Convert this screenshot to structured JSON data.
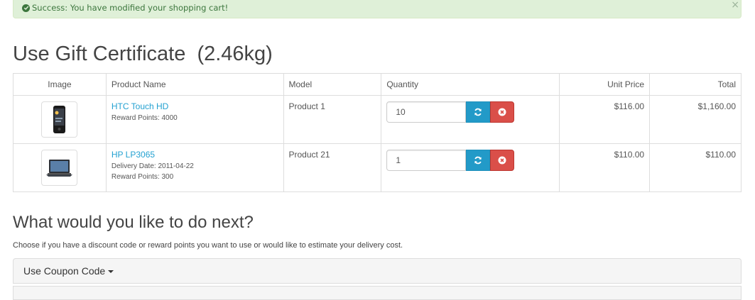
{
  "alert": {
    "message": "Success: You have modified your shopping cart!",
    "close": "×"
  },
  "page": {
    "title": "Use Gift Certificate  (2.46kg)"
  },
  "cart": {
    "headers": [
      "Image",
      "Product Name",
      "Model",
      "Quantity",
      "Unit Price",
      "Total"
    ],
    "rows": [
      {
        "name": "HTC Touch HD",
        "meta": [
          "Reward Points: 4000"
        ],
        "model": "Product 1",
        "quantity": "10",
        "unit_price": "$116.00",
        "total": "$1,160.00"
      },
      {
        "name": "HP LP3065",
        "meta": [
          "Delivery Date: 2011-04-22",
          "Reward Points: 300"
        ],
        "model": "Product 21",
        "quantity": "1",
        "unit_price": "$110.00",
        "total": "$110.00"
      }
    ]
  },
  "next": {
    "title": "What would you like to do next?",
    "description": "Choose if you have a discount code or reward points you want to use or would like to estimate your delivery cost."
  },
  "coupon_panel": {
    "label": "Use Coupon Code"
  },
  "colors": {
    "link": "#23a1d1",
    "refresh": "#229ac8",
    "remove": "#da4f49",
    "success_bg": "#dff0d8"
  },
  "icons": {
    "alert": "check-circle-icon",
    "refresh": "refresh-icon",
    "remove": "times-circle-icon",
    "caret": "caret-down-icon"
  }
}
